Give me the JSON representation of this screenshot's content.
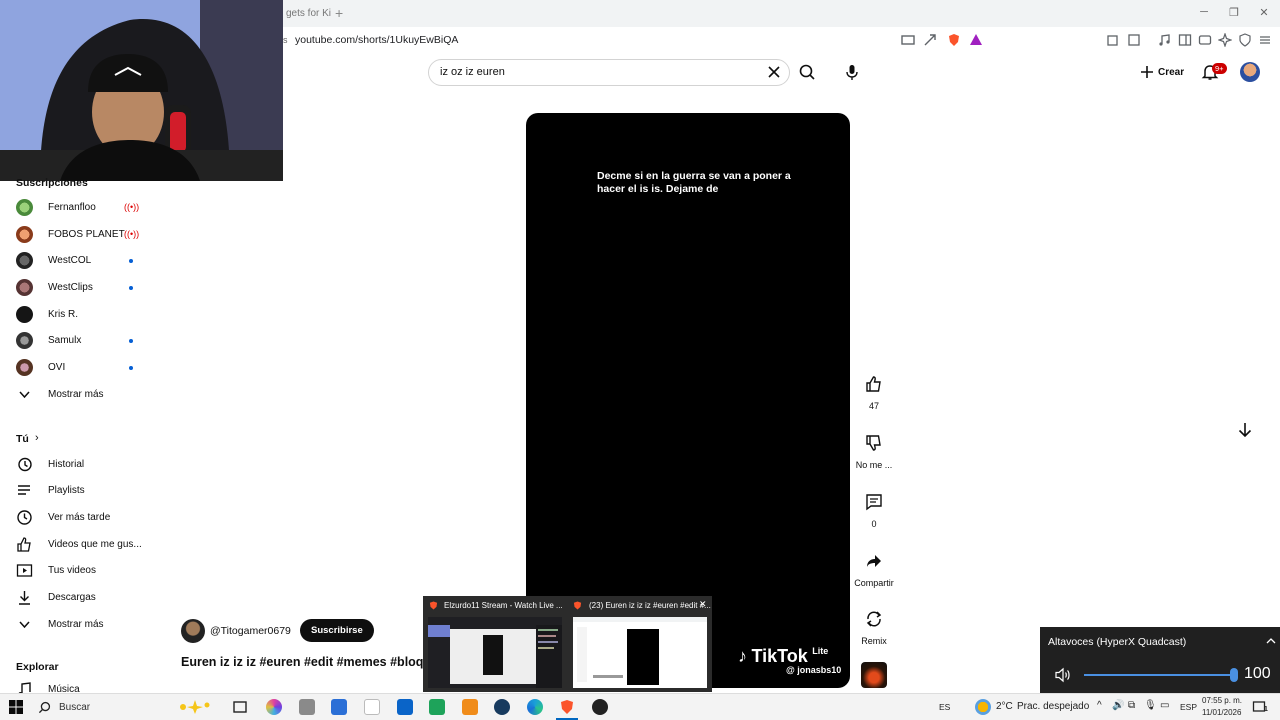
{
  "browser": {
    "tab_partial": "gets for Ki",
    "url": "youtube.com/shorts/1UkuyEwBiQA"
  },
  "header": {
    "search_value": "iz oz iz euren",
    "create_label": "Crear",
    "notif_badge": "9+"
  },
  "sidebar": {
    "subscriptions_heading": "Suscripciones",
    "subscriptions": [
      {
        "label": "Fernanfloo",
        "status": "live"
      },
      {
        "label": "FOBOS PLANET",
        "status": "live"
      },
      {
        "label": "WestCOL",
        "status": "new"
      },
      {
        "label": "WestClips",
        "status": "new"
      },
      {
        "label": "Kris R.",
        "status": "none"
      },
      {
        "label": "Samulx",
        "status": "new"
      },
      {
        "label": "OVI",
        "status": "new"
      }
    ],
    "subs_more": "Mostrar más",
    "you_heading": "Tú",
    "you_items": [
      {
        "label": "Historial",
        "icon": "history-icon"
      },
      {
        "label": "Playlists",
        "icon": "playlists-icon"
      },
      {
        "label": "Ver más tarde",
        "icon": "watch-later-icon"
      },
      {
        "label": "Videos que me gus...",
        "icon": "liked-videos-icon"
      },
      {
        "label": "Tus videos",
        "icon": "your-videos-icon"
      },
      {
        "label": "Descargas",
        "icon": "downloads-icon"
      },
      {
        "label": "Mostrar más",
        "icon": "chevron-down-icon"
      }
    ],
    "explore_heading": "Explorar",
    "explore_items": [
      {
        "label": "Música",
        "icon": "music-icon"
      }
    ]
  },
  "short": {
    "caption": "Decme si en la guerra se van a poner a hacer el is is. Dejame de",
    "watermark_brand": "TikTok",
    "watermark_suffix": "Lite",
    "watermark_handle": "@ jonasbs10",
    "likes": "47",
    "dislike_label": "No me ...",
    "comments": "0",
    "share_label": "Compartir",
    "remix_label": "Remix",
    "channel": "@Titogamer0679",
    "subscribe_label": "Suscribirse",
    "title": "Euren iz iz iz #euren #edit #memes #bloqueo"
  },
  "preview": {
    "window1_title": "Elzurdo11 Stream - Watch Live ...",
    "window2_title": "(23) Euren iz iz iz #euren #edit #..."
  },
  "volume": {
    "title": "Altavoces (HyperX Quadcast)",
    "level": 100,
    "value_text": "100"
  },
  "taskbar": {
    "search_label": "Buscar",
    "lang_short": "ES",
    "weather_temp": "2°C",
    "weather_desc": "Prac. despejado",
    "input_lang": "ESP",
    "time": "07:55 p. m.",
    "date": "11/01/2026",
    "notif_count": "1"
  },
  "colors": {
    "accent": "#cc0000",
    "live": "#dd0000",
    "new_dot": "#065fd4",
    "slider": "#4a90e2"
  }
}
